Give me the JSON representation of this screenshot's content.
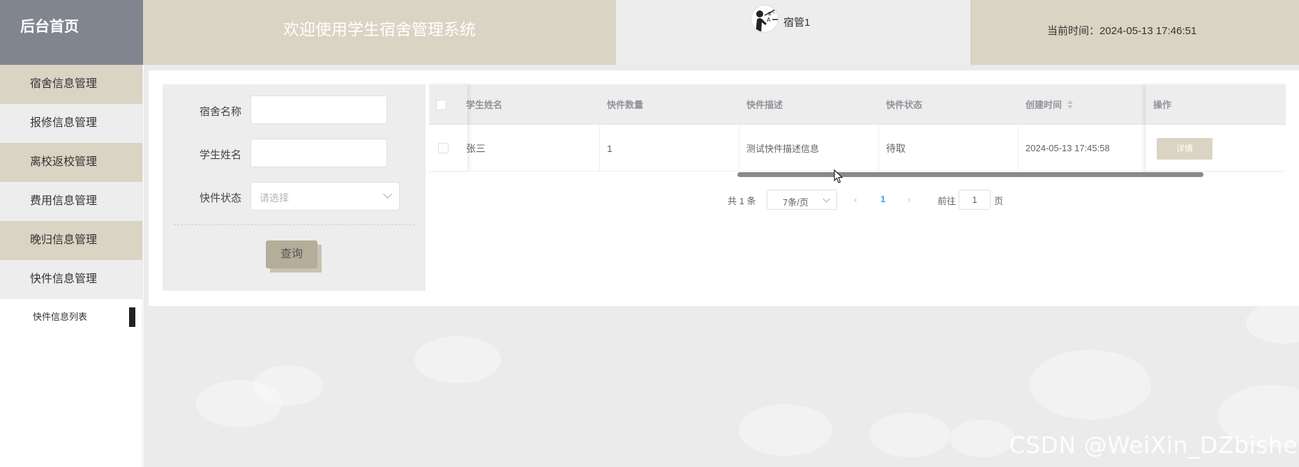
{
  "header": {
    "brand": "后台首页",
    "title": "欢迎使用学生宿舍管理系统",
    "username": "宿管1",
    "time_label": "当前时间：",
    "time_value": "2024-05-13 17:46:51"
  },
  "sidebar": {
    "items": [
      {
        "label": "宿舍信息管理"
      },
      {
        "label": "报修信息管理"
      },
      {
        "label": "离校返校管理"
      },
      {
        "label": "费用信息管理"
      },
      {
        "label": "晚归信息管理"
      },
      {
        "label": "快件信息管理"
      }
    ],
    "submenu": {
      "label": "快件信息列表"
    }
  },
  "search": {
    "dorm_label": "宿舍名称",
    "dorm_value": "",
    "student_label": "学生姓名",
    "student_value": "",
    "status_label": "快件状态",
    "status_placeholder": "请选择",
    "query_button": "查询"
  },
  "table": {
    "headers": [
      "学生姓名",
      "快件数量",
      "快件描述",
      "快件状态",
      "创建时间",
      "操作"
    ],
    "rows": [
      {
        "student": "张三",
        "count": "1",
        "description": "测试快件描述信息",
        "status": "待取",
        "created": "2024-05-13 17:45:58",
        "action": "详情"
      }
    ]
  },
  "pagination": {
    "total": "共 1 条",
    "page_size": "7条/页",
    "current_page": "1",
    "goto_label": "前往",
    "goto_value": "1",
    "page_suffix": "页"
  },
  "watermark": "CSDN @WeiXin_DZbishe",
  "colors": {
    "brand_bg": "#808590",
    "accent_tan": "#d9d4c3",
    "light_grey": "#ededed",
    "link_blue": "#409eff"
  }
}
